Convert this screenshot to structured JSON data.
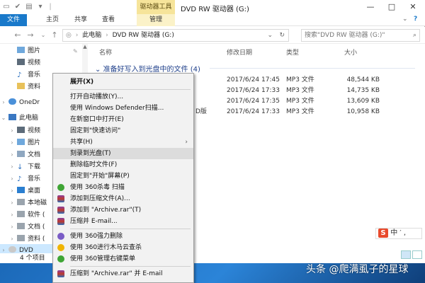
{
  "titlebar": {
    "title": "DVD RW 驱动器 (G:)",
    "context_tab_label": "驱动器工具",
    "minimize": "—",
    "maximize": "□",
    "close": "✕"
  },
  "ribbon": {
    "tabs": [
      "文件",
      "主页",
      "共享",
      "查看",
      "管理"
    ],
    "help": "?"
  },
  "address": {
    "path_parts": [
      "此电脑",
      "DVD RW 驱动器 (G:)"
    ],
    "search_placeholder": "搜索\"DVD RW 驱动器 (G:)\""
  },
  "nav": {
    "items": [
      {
        "label": "图片",
        "icon": "pictures-icon"
      },
      {
        "label": "视频",
        "icon": "videos-icon"
      },
      {
        "label": "音乐",
        "icon": "music-icon"
      },
      {
        "label": "资料",
        "icon": "folder-icon"
      },
      {
        "label": "OneDr",
        "icon": "onedrive-icon"
      },
      {
        "label": "此电脑",
        "icon": "pc-icon"
      },
      {
        "label": "视频",
        "icon": "videos-icon"
      },
      {
        "label": "图片",
        "icon": "pictures-icon"
      },
      {
        "label": "文档",
        "icon": "documents-icon"
      },
      {
        "label": "下载",
        "icon": "downloads-icon"
      },
      {
        "label": "音乐",
        "icon": "music-icon"
      },
      {
        "label": "桌面",
        "icon": "desktop-icon"
      },
      {
        "label": "本地磁",
        "icon": "drive-icon"
      },
      {
        "label": "软件 (",
        "icon": "drive-icon"
      },
      {
        "label": "文档 (",
        "icon": "drive-icon"
      },
      {
        "label": "资料 (",
        "icon": "drive-icon"
      },
      {
        "label": "DVD",
        "icon": "dvd-icon"
      }
    ]
  },
  "columns": {
    "name": "名称",
    "date": "修改日期",
    "type": "类型",
    "size": "大小"
  },
  "group_header": "准备好写入到光盘中的文件 (4)",
  "files": [
    {
      "name": "",
      "date": "2017/6/24 17:45",
      "type": "MP3 文件",
      "size": "48,544 KB"
    },
    {
      "name": "",
      "date": "2017/6/24 17:33",
      "type": "MP3 文件",
      "size": "14,735 KB"
    },
    {
      "name": "",
      "date": "2017/6/24 17:35",
      "type": "MP3 文件",
      "size": "13,609 KB"
    },
    {
      "name": "D版",
      "date": "2017/6/24 17:33",
      "type": "MP3 文件",
      "size": "10,958 KB"
    }
  ],
  "status": {
    "count": "4 个项目"
  },
  "ime": {
    "logo": "S",
    "text": "中 ′ ,"
  },
  "context_menu": {
    "items": [
      {
        "label": "展开(X)",
        "bold": true
      },
      {
        "label": "打开自动播放(Y)..."
      },
      {
        "label": "使用 Windows Defender扫描..."
      },
      {
        "label": "在新窗口中打开(E)"
      },
      {
        "label": "固定到\"快速访问\""
      },
      {
        "label": "共享(H)",
        "submenu": true
      },
      {
        "label": "刻录到光盘(T)",
        "highlighted": true
      },
      {
        "label": "删除临时文件(F)"
      },
      {
        "label": "固定到\"开始\"屏幕(P)"
      },
      {
        "label": "使用 360杀毒 扫描",
        "icon": "360-antivirus-icon"
      },
      {
        "label": "添加到压缩文件(A)...",
        "icon": "winrar-icon"
      },
      {
        "label": "添加到 \"Archive.rar\"(T)",
        "icon": "winrar-icon"
      },
      {
        "label": "压缩并 E-mail...",
        "icon": "winrar-icon"
      },
      {
        "label": "使用 360强力删除",
        "icon": "360-delete-icon"
      },
      {
        "label": "使用 360进行木马云查杀",
        "icon": "360-trojan-icon"
      },
      {
        "label": "使用 360管理右键菜单",
        "icon": "360-menu-icon"
      },
      {
        "label": "压缩到 \"Archive.rar\" 并 E-mail",
        "icon": "winrar-icon"
      }
    ]
  },
  "watermark": "头条 @爬满虱子的星球",
  "colors": {
    "accent": "#1979ca",
    "context_tab": "#f6e49a",
    "menu_bg": "#f2f2f2",
    "selected": "#cce8ff"
  }
}
